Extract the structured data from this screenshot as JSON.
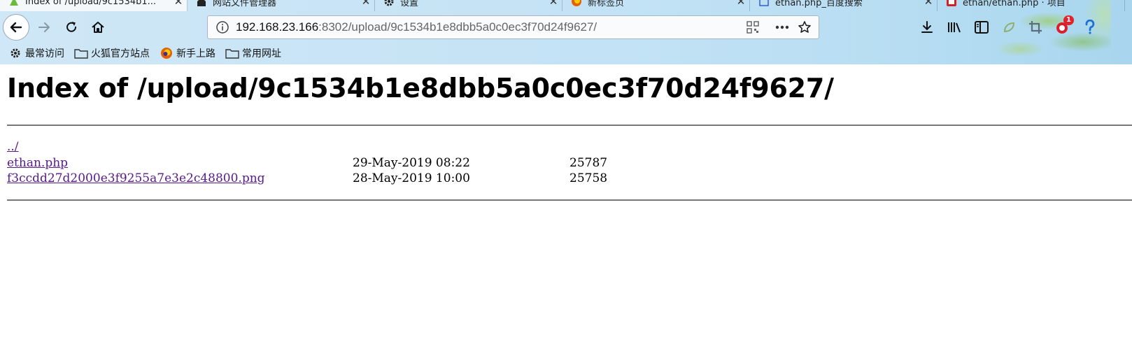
{
  "browser": {
    "tabs": [
      {
        "title": "Index of /upload/9c1534b1...",
        "active": true,
        "icon": "page-icon"
      },
      {
        "title": "网站文件管理器",
        "active": false,
        "icon": "site-icon"
      },
      {
        "title": "设置",
        "active": false,
        "icon": "gear-icon"
      },
      {
        "title": "新标签页",
        "active": false,
        "icon": "firefox-icon"
      },
      {
        "title": "ethan.php_百度搜索",
        "active": false,
        "icon": "doc-icon"
      },
      {
        "title": "ethan/ethan.php · 项目",
        "active": false,
        "icon": "repo-icon"
      }
    ],
    "close_glyph": "✕",
    "url": {
      "host": "192.168.23.166",
      "rest": ":8302/upload/9c1534b1e8dbb5a0c0ec3f70d24f9627/"
    },
    "bookmarks": [
      {
        "label": "最常访问",
        "icon": "gear-icon"
      },
      {
        "label": "火狐官方站点",
        "icon": "folder-icon"
      },
      {
        "label": "新手上路",
        "icon": "firefox-icon"
      },
      {
        "label": "常用网址",
        "icon": "folder-icon"
      }
    ],
    "notification_badge": "1",
    "accent": "#e0232e"
  },
  "page": {
    "title": "Index of /upload/9c1534b1e8dbb5a0c0ec3f70d24f9627/",
    "entries": [
      {
        "name": "../",
        "date": "",
        "size": ""
      },
      {
        "name": "ethan.php",
        "date": "29-May-2019 08:22",
        "size": "25787"
      },
      {
        "name": "f3ccdd27d2000e3f9255a7e3e2c48800.png",
        "date": "28-May-2019 10:00",
        "size": "25758"
      }
    ],
    "link_color": "#551a8b"
  }
}
